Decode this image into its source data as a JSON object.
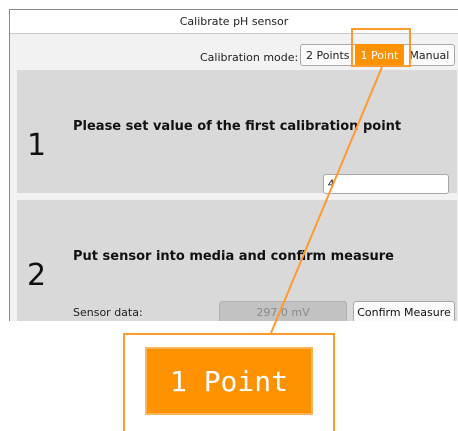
{
  "window": {
    "title": "Calibrate pH sensor"
  },
  "calibration_mode": {
    "label": "Calibration mode:",
    "options": [
      "2 Points",
      "1 Point",
      "Manual"
    ],
    "selected": "1 Point"
  },
  "step1": {
    "number": "1",
    "title": "Please set value of the first calibration point",
    "value": "4"
  },
  "step2": {
    "number": "2",
    "title": "Put sensor into media and confirm measure",
    "sensor_label": "Sensor data:",
    "sensor_value": "297.0 mV",
    "confirm_label": "Confirm Measure"
  },
  "zoom": {
    "label": "1 Point"
  },
  "colors": {
    "accent": "#ff9200",
    "highlight": "#ff9a2e",
    "panel": "#d9d9d9"
  }
}
